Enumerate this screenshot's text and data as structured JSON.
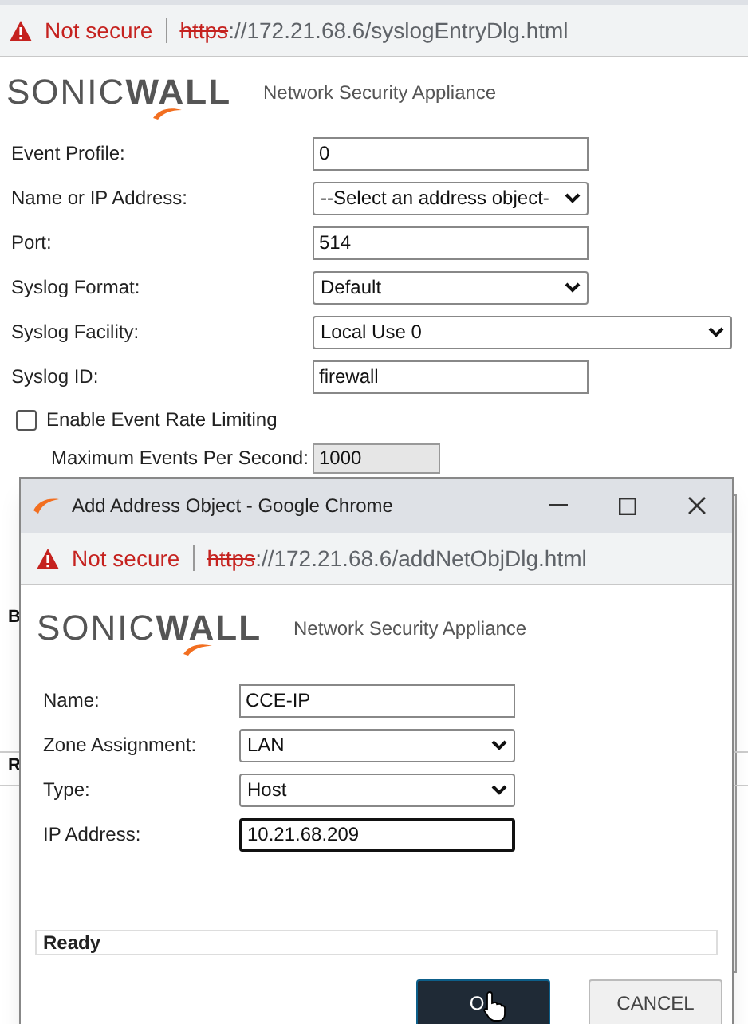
{
  "browser_bar": {
    "security": "Not secure",
    "url_scheme": "https",
    "url_rest": "://172.21.68.6/syslogEntryDlg.html"
  },
  "header": {
    "logo_light": "SONIC",
    "logo_bold": "WALL",
    "tagline": "Network Security Appliance"
  },
  "fields": [
    {
      "kind": "input",
      "label": "Event Profile:",
      "value": "0"
    },
    {
      "kind": "select",
      "label": "Name or IP Address:",
      "value": "--Select an address object-"
    },
    {
      "kind": "input",
      "label": "Port:",
      "value": "514"
    },
    {
      "kind": "select",
      "label": "Syslog Format:",
      "value": "Default"
    },
    {
      "kind": "wide-select",
      "label": "Syslog Facility:",
      "value": "Local Use 0"
    },
    {
      "kind": "input",
      "label": "Syslog ID:",
      "value": "firewall"
    }
  ],
  "rate_limit": {
    "label": "Enable Event Rate Limiting",
    "checked": false
  },
  "max_events": {
    "label": "Maximum Events Per Second:",
    "value": "1000",
    "disabled": true
  },
  "partial_texts": [
    "B",
    "R"
  ],
  "dialog": {
    "title": "Add Address Object - Google Chrome",
    "browser_bar": {
      "security": "Not secure",
      "url_scheme": "https",
      "url_rest": "://172.21.68.6/addNetObjDlg.html"
    },
    "header": {
      "logo_light": "SONIC",
      "logo_bold": "WALL",
      "tagline": "Network Security Appliance"
    },
    "fields": [
      {
        "kind": "input",
        "label": "Name:",
        "value": "CCE-IP",
        "focused": false
      },
      {
        "kind": "select",
        "label": "Zone Assignment:",
        "value": "LAN"
      },
      {
        "kind": "select",
        "label": "Type:",
        "value": "Host"
      },
      {
        "kind": "input",
        "label": "IP Address:",
        "value": "10.21.68.209",
        "focused": true
      }
    ],
    "status": "Ready",
    "buttons": [
      {
        "kind": "primary",
        "label": "O"
      },
      {
        "kind": "secondary",
        "label": "CANCEL"
      }
    ]
  }
}
